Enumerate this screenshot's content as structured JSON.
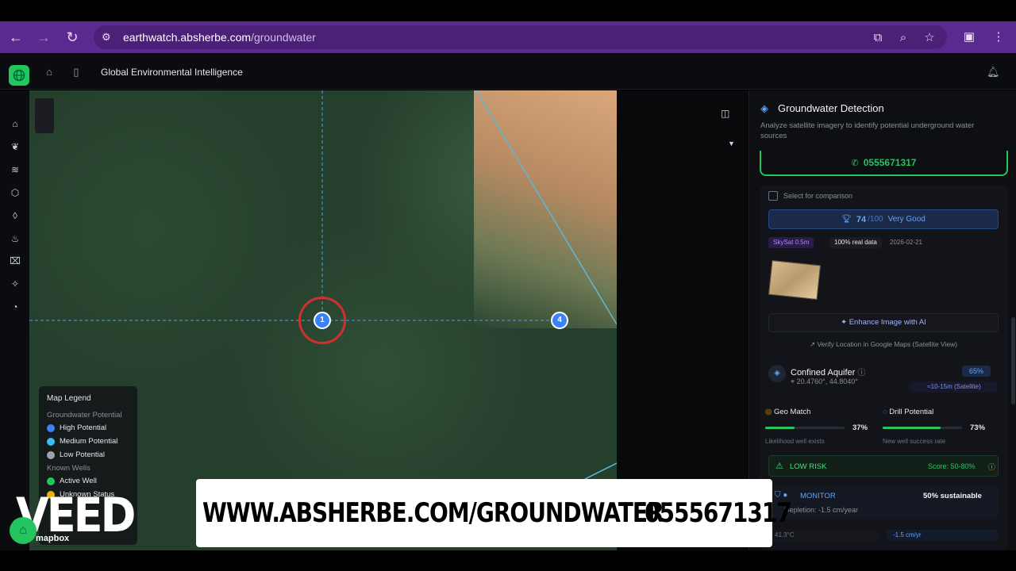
{
  "browser": {
    "url_domain": "earthwatch.absherbe.com",
    "url_path": "/groundwater"
  },
  "app": {
    "title": "Global Environmental Intelligence"
  },
  "map": {
    "markers": [
      "1",
      "4"
    ],
    "legend": {
      "title": "Map Legend",
      "section_potential": "Groundwater Potential",
      "high": "High Potential",
      "medium": "Medium Potential",
      "low": "Low Potential",
      "section_wells": "Known Wells",
      "active": "Active Well",
      "unknown": "Unknown Status",
      "colors": {
        "high": "#3b82f6",
        "medium": "#38bdf8",
        "low": "#9ca3af",
        "active": "#22c55e",
        "unknown": "#eab308"
      }
    },
    "attribution": "mapbox"
  },
  "panel": {
    "title": "Groundwater Detection",
    "subtitle": "Analyze satellite imagery to identify potential underground water sources",
    "phone": "0555671317",
    "compare_label": "Select for comparison",
    "score": "74",
    "score_max": "/100",
    "score_label": "Very Good",
    "chip_source": "SkySat 0.5m",
    "chip_real": "100% real data",
    "chip_date": "2026-02-21",
    "enhance_label": "Enhance Image with AI",
    "verify_label": "Verify Location in Google Maps (Satellite View)",
    "aquifer_title": "Confined Aquifer",
    "coords": "20.4760°, 44.8040°",
    "aquifer_pct": "65%",
    "resolution_chip": "≈10-15m (Satellite)",
    "geo_match": {
      "title": "Geo Match",
      "value": "37%",
      "fraction": 0.37,
      "sub": "Likelihood well exists"
    },
    "drill": {
      "title": "Drill Potential",
      "value": "73%",
      "fraction": 0.73,
      "sub": "New well success rate"
    },
    "risk_label": "LOW RISK",
    "risk_score": "Score: 50-80%",
    "monitor_label": "MONITOR",
    "monitor_value": "50% sustainable",
    "depletion": "Depletion: -1.5 cm/year",
    "temp": "41.3°C",
    "rate": "-1.5 cm/yr"
  },
  "overlay": {
    "brand": "VEED",
    "url": "WWW.ABSHERBE.COM/GROUNDWATER",
    "phone": "0555671317"
  }
}
